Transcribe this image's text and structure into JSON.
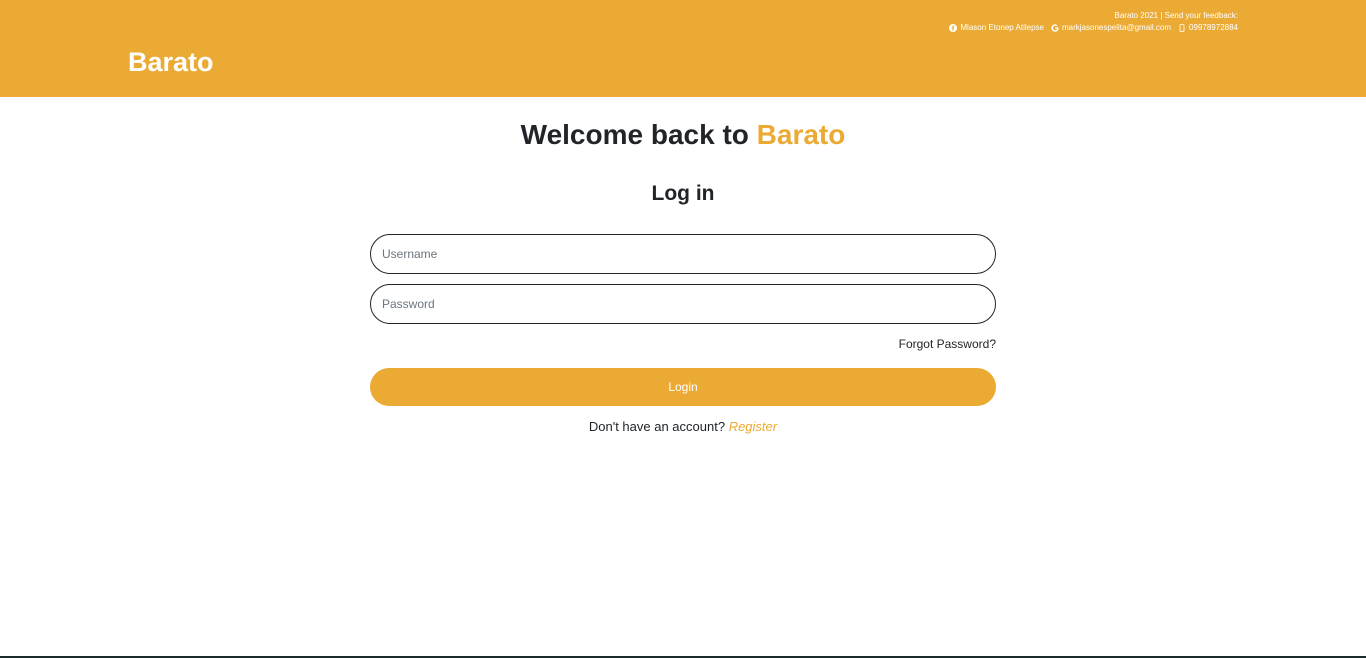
{
  "colors": {
    "accent": "#EBAA33",
    "text": "#212529",
    "white": "#ffffff"
  },
  "header": {
    "brand": "Barato",
    "feedback_line": "Barato 2021 | Send your feedback:",
    "contacts": [
      {
        "icon": "facebook-icon",
        "text": "Mlason Etonep Atilepse"
      },
      {
        "icon": "google-icon",
        "text": "markjasonespelita@gmail.com"
      },
      {
        "icon": "mobile-phone-icon",
        "text": "09978972884"
      }
    ]
  },
  "main": {
    "welcome_prefix": "Welcome back to ",
    "welcome_brand": "Barato",
    "login_heading": "Log in",
    "username_placeholder": "Username",
    "username_value": "",
    "password_placeholder": "Password",
    "password_value": "",
    "forgot_label": "Forgot Password?",
    "login_button": "Login",
    "register_prompt": "Don't have an account? ",
    "register_link": "Register"
  }
}
